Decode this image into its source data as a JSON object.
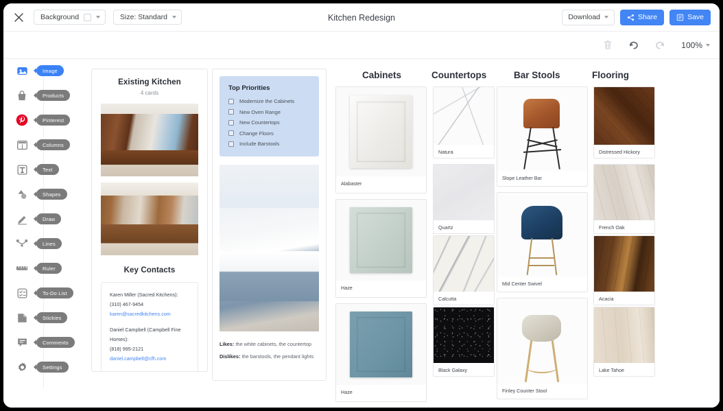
{
  "topbar": {
    "close_icon": "close-icon",
    "background_label": "Background",
    "size_label": "Size: Standard",
    "doc_title": "Kitchen Redesign",
    "download_label": "Download",
    "share_label": "Share",
    "save_label": "Save"
  },
  "subbar": {
    "trash_icon": "trash-icon",
    "undo_icon": "undo-icon",
    "redo_icon": "redo-icon",
    "zoom_level": "100%"
  },
  "sidebar": {
    "items": [
      {
        "label": "Image",
        "icon": "image-icon",
        "active": true
      },
      {
        "label": "Products",
        "icon": "bag-icon",
        "active": false
      },
      {
        "label": "Pinterest",
        "icon": "pinterest-icon",
        "active": false
      },
      {
        "label": "Columns",
        "icon": "columns-icon",
        "active": false
      },
      {
        "label": "Text",
        "icon": "text-icon",
        "active": false
      },
      {
        "label": "Shapes",
        "icon": "shapes-icon",
        "active": false
      },
      {
        "label": "Draw",
        "icon": "pencil-icon",
        "active": false
      },
      {
        "label": "Lines",
        "icon": "lines-icon",
        "active": false
      },
      {
        "label": "Ruler",
        "icon": "ruler-icon",
        "active": false
      },
      {
        "label": "To-Do List",
        "icon": "todo-icon",
        "active": false
      },
      {
        "label": "Stickies",
        "icon": "sticky-icon",
        "active": false
      },
      {
        "label": "Comments",
        "icon": "comment-icon",
        "active": false
      },
      {
        "label": "Settings",
        "icon": "gear-icon",
        "active": false
      }
    ]
  },
  "existing_kitchen_card": {
    "title": "Existing Kitchen",
    "subtitle": "4 cards",
    "contacts_title": "Key Contacts",
    "contacts": [
      {
        "name": "Karen Miller (Sacred Kitchens):",
        "phone": "(310) 467-9454",
        "email": "karen@sacredkitchens.com"
      },
      {
        "name": "Daniel Campbell (Campbell Fine Homes):",
        "phone": "(818) 995-2121",
        "email": "daniel.campbell@cfh.com"
      }
    ]
  },
  "priorities_card": {
    "title": "Top Priorities",
    "items": [
      "Modernize the Cabinets",
      "New Oven Range",
      "New Countertops",
      "Change Floors",
      "Include Barstools"
    ],
    "likes_label": "Likes:",
    "likes_text": "the white cabinets, the countertop",
    "dislikes_label": "Dislikes:",
    "dislikes_text": "the barstools, the pendant lights"
  },
  "columns": [
    {
      "header": "Cabinets",
      "items": [
        {
          "label": "Alabaster"
        },
        {
          "label": "Haze"
        },
        {
          "label": "Haze"
        }
      ]
    },
    {
      "header": "Countertops",
      "items": [
        {
          "label": "Natura"
        },
        {
          "label": "Quartz"
        },
        {
          "label": "Calcutta"
        },
        {
          "label": "Black Galaxy"
        }
      ]
    },
    {
      "header": "Bar Stools",
      "items": [
        {
          "label": "Slope Leather Bar"
        },
        {
          "label": "Mid Center Swivel"
        },
        {
          "label": "Finley Counter Stool"
        }
      ]
    },
    {
      "header": "Flooring",
      "items": [
        {
          "label": "Distressed Hickory"
        },
        {
          "label": "French Oak"
        },
        {
          "label": "Acacia"
        },
        {
          "label": "Lake Tahoe"
        }
      ]
    }
  ],
  "colors": {
    "accent_blue": "#4285f4",
    "priority_panel": "#ccdcf2",
    "tooltip_gray": "#7b7b7b",
    "pinterest_red": "#e60023"
  }
}
